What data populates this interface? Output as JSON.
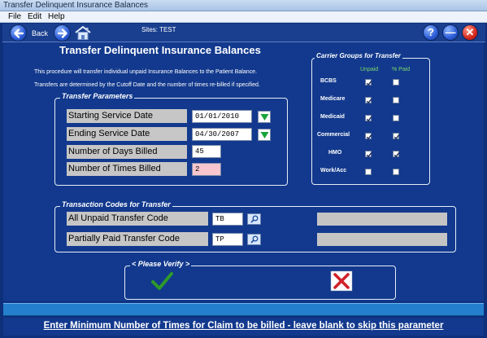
{
  "window": {
    "title": "Transfer Delinquent Insurance Balances"
  },
  "menu": {
    "items": [
      "File",
      "Edit",
      "Help"
    ]
  },
  "toolbar": {
    "back_label": "Back",
    "sites_text": "Sites: TEST"
  },
  "page": {
    "title": "Transfer Delinquent Insurance Balances",
    "intro_line1": "This procedure will transfer individual unpaid Insurance Balances to the Patient Balance.",
    "intro_line2": "Transfers are determined by the Cutoff Date and the number of times re-billed if specified."
  },
  "transfer_params": {
    "legend": "Transfer Parameters",
    "starting_label": "Starting Service Date",
    "starting_value": "01/01/2010",
    "ending_label": "Ending Service Date",
    "ending_value": "04/30/2007",
    "days_label": "Number of Days Billed",
    "days_value": "45",
    "times_label": "Number of Times Billed",
    "times_value": "2"
  },
  "carrier_groups": {
    "legend": "Carrier Groups for Transfer",
    "col_unpaid": "Unpaid",
    "col_paid": "% Paid",
    "rows": [
      {
        "name": "BCBS",
        "unpaid": true,
        "paid": false
      },
      {
        "name": "Medicare",
        "unpaid": true,
        "paid": false
      },
      {
        "name": "Medicaid",
        "unpaid": true,
        "paid": false
      },
      {
        "name": "Commercial",
        "unpaid": true,
        "paid": true
      },
      {
        "name": "HMO",
        "unpaid": true,
        "paid": true
      },
      {
        "name": "Work/Acc",
        "unpaid": false,
        "paid": false
      }
    ]
  },
  "transaction_codes": {
    "legend": "Transaction Codes for Transfer",
    "unpaid_label": "All Unpaid Transfer Code",
    "unpaid_value": "TB",
    "partial_label": "Partially Paid Transfer Code",
    "partial_value": "TP"
  },
  "verify": {
    "legend": "< Please Verify >"
  },
  "status": {
    "message": "Enter Minimum Number of Times for Claim to be billed - leave blank to skip this parameter"
  },
  "colors": {
    "background": "#12398d",
    "accent": "#2480cf",
    "confirm": "#2f9a2a",
    "cancel": "#d0212a"
  }
}
